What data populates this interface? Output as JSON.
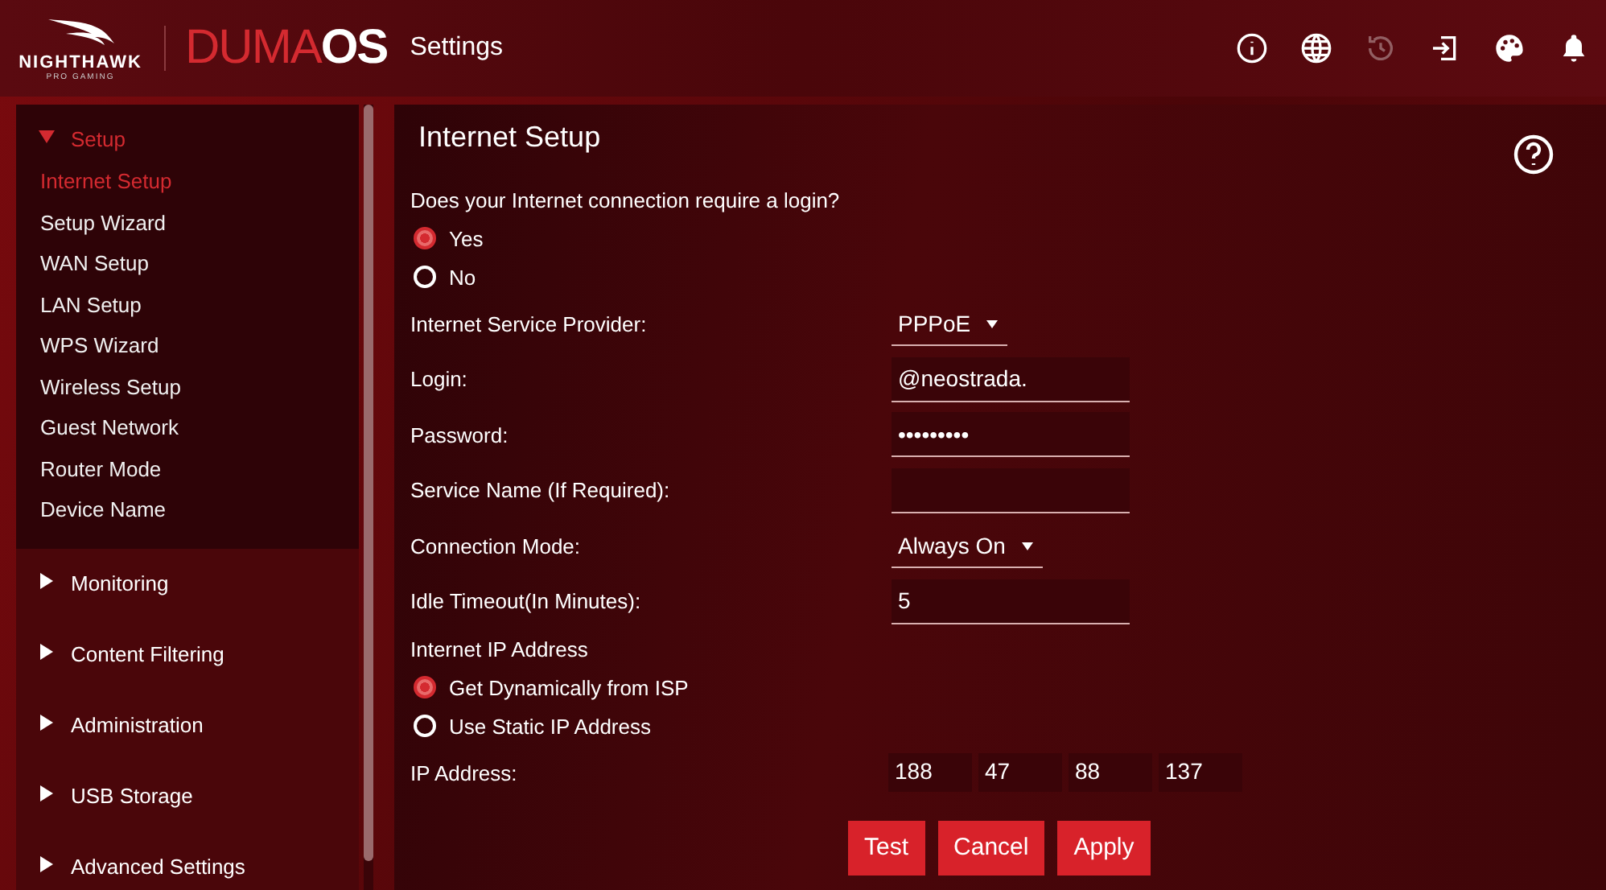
{
  "header": {
    "brand": {
      "name": "NIGHTHAWK",
      "tagline": "PRO GAMING"
    },
    "product": {
      "prefix": "DUMA",
      "suffix": "OS"
    },
    "page_title": "Settings",
    "icons": [
      {
        "kind": "info",
        "disabled": false
      },
      {
        "kind": "globe",
        "disabled": false
      },
      {
        "kind": "history",
        "disabled": true
      },
      {
        "kind": "logout",
        "disabled": false
      },
      {
        "kind": "palette",
        "disabled": false
      },
      {
        "kind": "bell",
        "disabled": false
      }
    ]
  },
  "sidebar": {
    "sections": [
      {
        "label": "Setup",
        "expanded": true,
        "children": [
          {
            "label": "Internet Setup",
            "selected": true
          },
          {
            "label": "Setup Wizard",
            "selected": false
          },
          {
            "label": "WAN Setup",
            "selected": false
          },
          {
            "label": "LAN Setup",
            "selected": false
          },
          {
            "label": "WPS Wizard",
            "selected": false
          },
          {
            "label": "Wireless Setup",
            "selected": false
          },
          {
            "label": "Guest Network",
            "selected": false
          },
          {
            "label": "Router Mode",
            "selected": false
          },
          {
            "label": "Device Name",
            "selected": false
          }
        ]
      },
      {
        "label": "Monitoring",
        "expanded": false
      },
      {
        "label": "Content Filtering",
        "expanded": false
      },
      {
        "label": "Administration",
        "expanded": false
      },
      {
        "label": "USB Storage",
        "expanded": false
      },
      {
        "label": "Advanced Settings",
        "expanded": false
      }
    ]
  },
  "main": {
    "title": "Internet Setup",
    "rows": [
      {
        "kind": "heading",
        "label": "Does your Internet connection require a login?"
      },
      {
        "kind": "radio",
        "label": "Yes",
        "selected": true
      },
      {
        "kind": "radio",
        "label": "No",
        "selected": false
      },
      {
        "kind": "select",
        "label": "Internet Service Provider:",
        "value": "PPPoE"
      },
      {
        "kind": "text",
        "label": "Login:",
        "value": "@neostrada."
      },
      {
        "kind": "password",
        "label": "Password:",
        "value": "•••••••••"
      },
      {
        "kind": "text",
        "label": "Service Name (If Required):"
      },
      {
        "kind": "select",
        "label": "Connection Mode:",
        "value": "Always On"
      },
      {
        "kind": "text",
        "label": "Idle Timeout(In Minutes):",
        "value": "5"
      },
      {
        "kind": "heading",
        "label": "Internet IP Address"
      },
      {
        "kind": "radio",
        "label": "Get Dynamically from ISP",
        "selected": true
      },
      {
        "kind": "radio",
        "label": "Use Static IP Address",
        "selected": false
      },
      {
        "kind": "ip",
        "label": "IP Address:",
        "octets": [
          "188",
          "47",
          "88",
          "137"
        ]
      }
    ],
    "buttons": [
      "Test",
      "Cancel",
      "Apply"
    ]
  }
}
